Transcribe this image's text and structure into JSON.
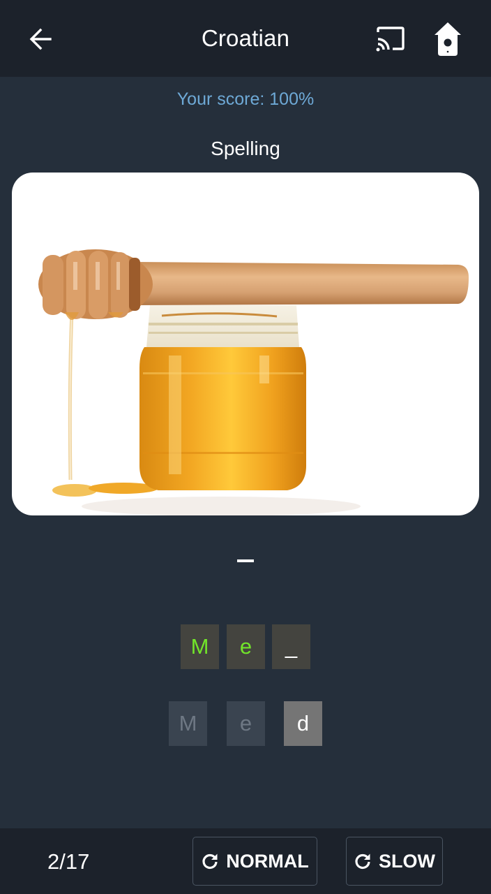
{
  "header": {
    "title": "Croatian",
    "back_icon": "arrow-left-icon",
    "cast_icon": "cast-icon",
    "home_icon": "birdhouse-home-icon"
  },
  "score": {
    "text": "Your score: 100%",
    "value_percent": 100
  },
  "exercise": {
    "mode": "Spelling",
    "image_description": "Honey jar with wooden honey dipper",
    "answer_display": "_",
    "answer_slots": [
      {
        "letter": "M",
        "state": "correct"
      },
      {
        "letter": "e",
        "state": "correct"
      },
      {
        "letter": "_",
        "state": "empty"
      }
    ],
    "letter_choices": [
      {
        "letter": "M",
        "state": "used"
      },
      {
        "letter": "e",
        "state": "used"
      },
      {
        "letter": "d",
        "state": "available"
      }
    ]
  },
  "footer": {
    "progress": "2/17",
    "progress_current": 2,
    "progress_total": 17,
    "normal_label": "NORMAL",
    "slow_label": "SLOW",
    "replay_icon": "replay-icon"
  },
  "colors": {
    "background": "#252f3b",
    "bars": "#1c222b",
    "score_text": "#6ea9d6",
    "correct_letter": "#72e52a"
  }
}
